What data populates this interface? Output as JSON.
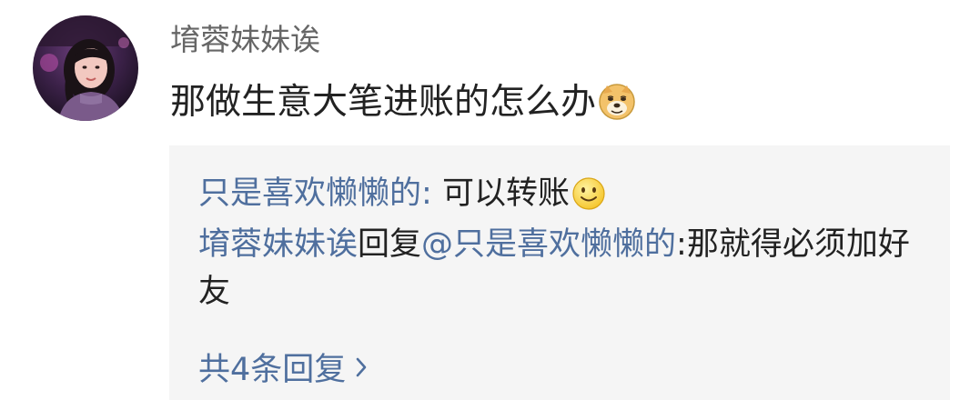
{
  "comment": {
    "username": "堉蓉妹妹诶",
    "text": "那做生意大笔进账的怎么办",
    "emoji_icon": "doge-emoji-icon"
  },
  "replies": [
    {
      "author": "只是喜欢懒懒的",
      "separator": ": ",
      "text": "可以转账",
      "emoji_icon": "smile-emoji-icon"
    },
    {
      "author": "堉蓉妹妹诶",
      "reply_word": "回复",
      "mention": "@只是喜欢懒懒的",
      "separator": ":",
      "text": "那就得必须加好友"
    }
  ],
  "more_replies": {
    "label": "共4条回复",
    "icon": "chevron-right-icon"
  },
  "colors": {
    "link_blue": "#4f6f9e",
    "reply_background": "#f5f5f5",
    "username_gray": "#666666",
    "text": "#222222"
  }
}
